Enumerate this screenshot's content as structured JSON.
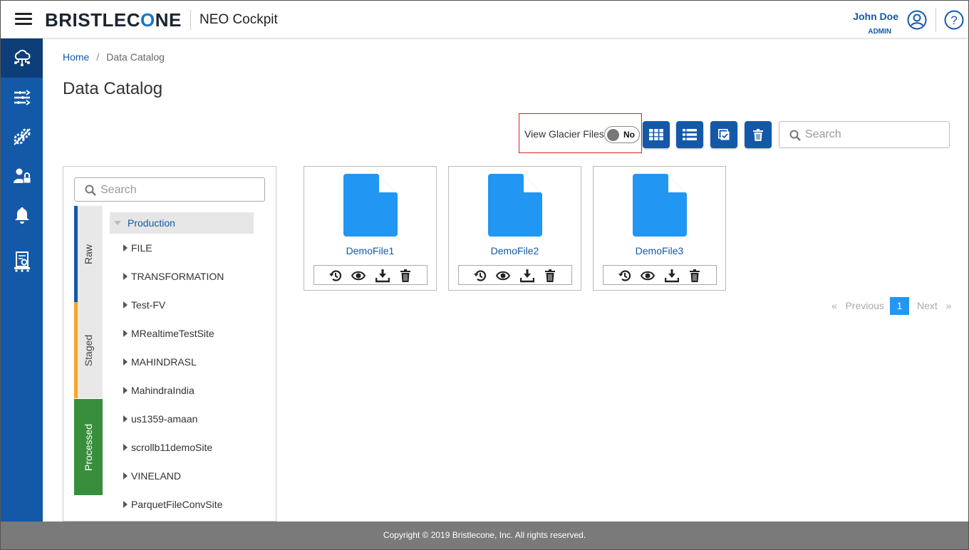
{
  "header": {
    "logo_text_pre": "BRISTLEC",
    "logo_text_o": "O",
    "logo_text_post": "NE",
    "app_title": "NEO Cockpit",
    "user_name": "John Doe",
    "user_role": "ADMIN"
  },
  "sidebar": {
    "items": [
      {
        "icon": "cloud-network-icon",
        "active": true
      },
      {
        "icon": "filter-lines-icon",
        "active": false
      },
      {
        "icon": "gears-icon",
        "active": false
      },
      {
        "icon": "user-lock-icon",
        "active": false
      },
      {
        "icon": "bell-icon",
        "active": false
      },
      {
        "icon": "report-settings-icon",
        "active": false
      }
    ]
  },
  "breadcrumb": {
    "home": "Home",
    "separator": "/",
    "current": "Data Catalog"
  },
  "page_title": "Data Catalog",
  "toolbar": {
    "glacier_label": "View Glacier Files",
    "glacier_toggle": "No",
    "search_placeholder": "Search",
    "buttons": [
      "grid-view-icon",
      "list-view-icon",
      "select-all-icon",
      "delete-icon"
    ]
  },
  "left_panel": {
    "search_placeholder": "Search",
    "stages": [
      {
        "label": "Raw",
        "color": "#1459a8"
      },
      {
        "label": "Staged",
        "color": "#f5a623"
      },
      {
        "label": "Processed",
        "color": "#388e3c"
      }
    ],
    "root": "Production",
    "items": [
      "FILE",
      "TRANSFORMATION",
      "Test-FV",
      "MRealtimeTestSite",
      "MAHINDRASL",
      "MahindraIndia",
      "us1359-amaan",
      "scrollb11demoSite",
      "VINELAND",
      "ParquetFileConvSite"
    ]
  },
  "files": [
    {
      "name": "DemoFile1"
    },
    {
      "name": "DemoFile2"
    },
    {
      "name": "DemoFile3"
    }
  ],
  "file_actions": [
    "history-icon",
    "view-icon",
    "download-icon",
    "trash-icon"
  ],
  "pagination": {
    "prev": "«   Previous",
    "current": "1",
    "next": "Next   »"
  },
  "footer": "Copyright © 2019 Bristlecone, Inc. All rights reserved.",
  "colors": {
    "primary": "#1459a8",
    "file_icon": "#2196f3",
    "highlight_border": "#d9201f"
  }
}
